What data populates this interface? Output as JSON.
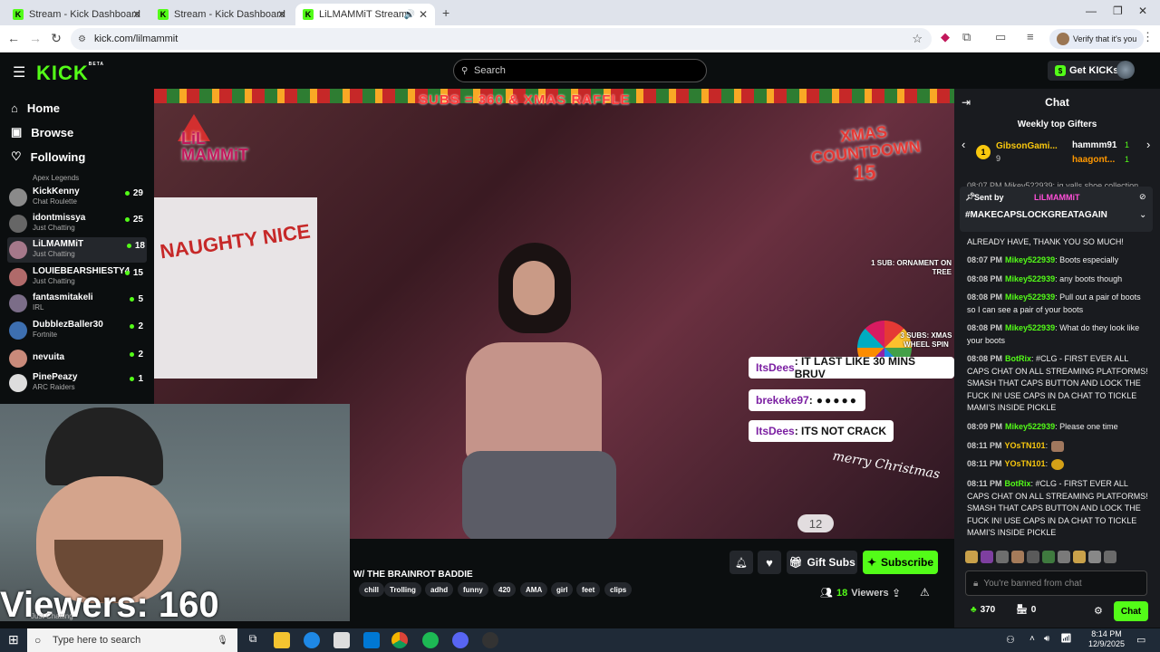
{
  "browser": {
    "tabs": [
      {
        "title": "Stream - Kick Dashboard"
      },
      {
        "title": "Stream - Kick Dashboard"
      },
      {
        "title": "LiLMAMMiT Stream - Watch"
      }
    ],
    "url": "kick.com/lilmammit",
    "verify_label": "Verify that it's you"
  },
  "header": {
    "logo": "KICK",
    "logo_badge": "BETA",
    "search_placeholder": "Search",
    "get_kicks": "Get KICKs"
  },
  "sidebar": {
    "nav": [
      {
        "label": "Home"
      },
      {
        "label": "Browse"
      },
      {
        "label": "Following"
      }
    ],
    "partial_category": "Apex Legends",
    "channels": [
      {
        "name": "KickKenny",
        "category": "Chat Roulette",
        "viewers": "29"
      },
      {
        "name": "idontmissya",
        "category": "Just Chatting",
        "viewers": "25"
      },
      {
        "name": "LiLMAMMiT",
        "category": "Just Chatting",
        "viewers": "18"
      },
      {
        "name": "LOUIEBEARSHIESTY4",
        "category": "Just Chatting",
        "viewers": "15"
      },
      {
        "name": "fantasmitakeli",
        "category": "IRL",
        "viewers": "5"
      },
      {
        "name": "DubblezBaller30",
        "category": "Fortnite",
        "viewers": "2"
      },
      {
        "name": "nevuita",
        "category": "",
        "viewers": "2"
      },
      {
        "name": "PinePeazy",
        "category": "ARC Raiders",
        "viewers": "1"
      }
    ]
  },
  "overlay": {
    "banner": "SUBS = 360 & XMAS RAFFLE",
    "countdown_title": "XMAS COUNTDOWN",
    "countdown_value": "15",
    "corner_logo": "LiL MAMMiT",
    "sign_text": "NAUGHTY NICE",
    "ornament_text": "1 SUB: ORNAMENT ON TREE",
    "wheel_text": "3 SUBS: XMAS WHEEL SPIN",
    "chat_bubbles": [
      {
        "user": "ItsDees",
        "text": ": IT LAST LIKE 30 MINS BRUV"
      },
      {
        "user": "brekeke97",
        "text": ":"
      },
      {
        "user": "ItsDees",
        "text": ": ITS NOT CRACK"
      }
    ],
    "merry": "merry Christmas",
    "counter": "12",
    "webcam_viewers": "Viewers: 160",
    "webcam_below": "Just Chatting"
  },
  "stream": {
    "title": "W/ THE BRAINROT BADDIE",
    "tags": [
      "chill",
      "Trolling",
      "adhd",
      "funny",
      "420",
      "AMA",
      "girl",
      "feet",
      "clips"
    ],
    "gift_subs": "Gift Subs",
    "subscribe": "Subscribe",
    "viewers_count": "18",
    "viewers_label": "Viewers"
  },
  "chat": {
    "title": "Chat",
    "gifters_title": "Weekly top Gifters",
    "gifters": [
      {
        "rank": "1",
        "name": "GibsonGami...",
        "count": "9"
      },
      {
        "name": "hammm91",
        "count": "1"
      },
      {
        "name": "haagont...",
        "count": "1"
      }
    ],
    "partial_top": "08:07 PM Mikey522939: ig yalls shoe collection",
    "pinned": {
      "label": "Sent by",
      "sender": "LiLMAMMiT",
      "text": "#MAKECAPSLOCKGREATAGAIN"
    },
    "messages": [
      {
        "time": "",
        "user": "",
        "text": "ALREADY HAVE, THANK YOU SO MUCH!"
      },
      {
        "time": "08:07 PM",
        "user": "Mikey522939",
        "text": ": Boots especially"
      },
      {
        "time": "08:08 PM",
        "user": "Mikey522939",
        "text": ": any boots though"
      },
      {
        "time": "08:08 PM",
        "user": "Mikey522939",
        "text": ": Pull out a pair of boots so I can see a pair of your boots"
      },
      {
        "time": "08:08 PM",
        "user": "Mikey522939",
        "text": ": What do they look like your boots"
      },
      {
        "time": "08:08 PM",
        "user": "BotRix",
        "text": ": #CLG - FIRST EVER ALL CAPS CHAT ON ALL STREAMING PLATFORMS! SMASH THAT CAPS BUTTON AND LOCK THE FUCK IN! USE CAPS IN DA CHAT TO TICKLE MAMI'S INSIDE PICKLE"
      },
      {
        "time": "08:09 PM",
        "user": "Mikey522939",
        "text": ": Please one time"
      },
      {
        "time": "08:11 PM",
        "user": "YOsTN101",
        "text": ":"
      },
      {
        "time": "08:11 PM",
        "user": "YOsTN101",
        "text": ":"
      },
      {
        "time": "08:11 PM",
        "user": "BotRix",
        "text": ": #CLG - FIRST EVER ALL CAPS CHAT ON ALL STREAMING PLATFORMS! SMASH THAT CAPS BUTTON AND LOCK THE FUCK IN! USE CAPS IN DA CHAT TO TICKLE MAMI'S INSIDE PICKLE"
      }
    ],
    "banned_placeholder": "You're banned from chat",
    "kicks_count": "370",
    "zero_count": "0",
    "chat_button": "Chat"
  },
  "taskbar": {
    "search_placeholder": "Type here to search",
    "time": "8:14 PM",
    "date": "12/9/2025"
  }
}
